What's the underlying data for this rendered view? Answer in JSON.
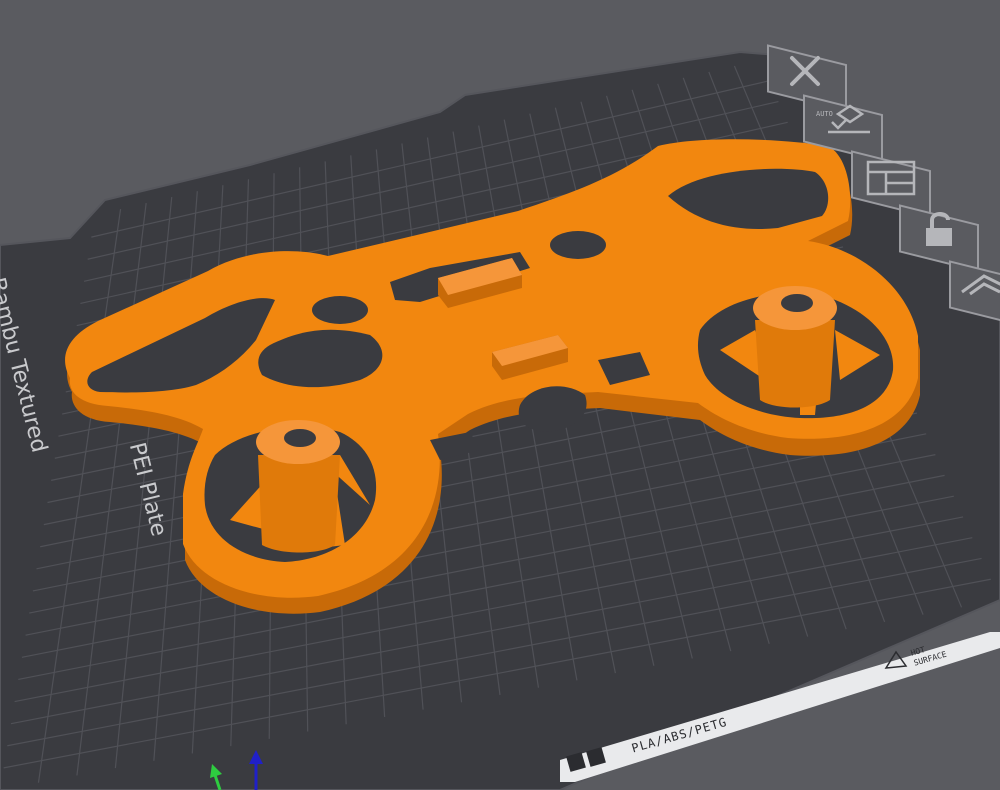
{
  "plate": {
    "name_line1": "Bambu Textured",
    "name_line2": "PEI Plate",
    "filament_strip": "PLA/ABS/PETG",
    "hot_surface_line1": "HOT",
    "hot_surface_line2": "SURFACE"
  },
  "toolbar": {
    "items": [
      {
        "icon": "close-icon"
      },
      {
        "icon": "auto-orient-icon",
        "label": "AUTO"
      },
      {
        "icon": "arrange-icon"
      },
      {
        "icon": "lock-icon"
      },
      {
        "icon": "plate-settings-icon"
      }
    ]
  },
  "colors": {
    "background": "#5a5b60",
    "plate": "#3a3b40",
    "grid": "#4f5056",
    "model": "#f2870f",
    "model_shade": "#c86a08",
    "axis_y": "#2ecc40",
    "axis_z": "#2020c8"
  }
}
